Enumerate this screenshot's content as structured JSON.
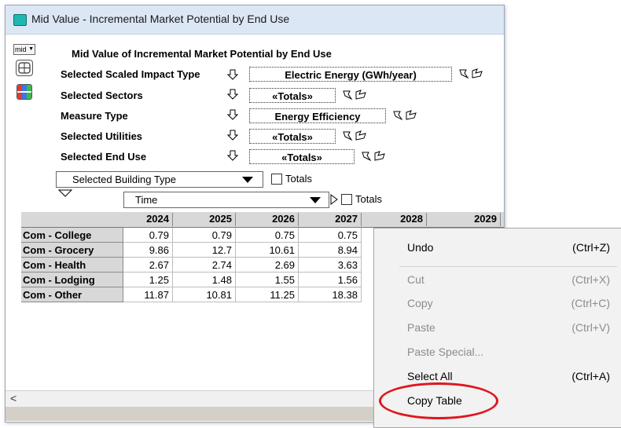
{
  "window": {
    "title": "Mid Value - Incremental Market Potential by End Use",
    "accent_color": "#1fb8b0",
    "titlebar_color": "#dbe7f5"
  },
  "mid_selector": {
    "value": "mid"
  },
  "panel": {
    "title": "Mid Value of Incremental Market Potential by End Use",
    "rows": [
      {
        "label": "Selected Scaled Impact Type",
        "value": "Electric Energy (GWh/year)"
      },
      {
        "label": "Selected Sectors",
        "value": "«Totals»"
      },
      {
        "label": "Measure Type",
        "value": "Energy Efficiency"
      },
      {
        "label": "Selected Utilities",
        "value": "«Totals»"
      },
      {
        "label": "Selected End Use",
        "value": "«Totals»"
      }
    ]
  },
  "building_type_select": {
    "value": "Selected Building Type",
    "totals_label": "Totals"
  },
  "time_select": {
    "value": "Time",
    "totals_label": "Totals"
  },
  "table": {
    "columns": [
      "2024",
      "2025",
      "2026",
      "2027",
      "2028",
      "2029"
    ],
    "rows": [
      {
        "label": "Com - College",
        "values": [
          "0.79",
          "0.79",
          "0.75",
          "0.75"
        ]
      },
      {
        "label": "Com - Grocery",
        "values": [
          "9.86",
          "12.7",
          "10.61",
          "8.94"
        ]
      },
      {
        "label": "Com - Health",
        "values": [
          "2.67",
          "2.74",
          "2.69",
          "3.63"
        ]
      },
      {
        "label": "Com - Lodging",
        "values": [
          "1.25",
          "1.48",
          "1.55",
          "1.56"
        ]
      },
      {
        "label": "Com - Other",
        "values": [
          "11.87",
          "10.81",
          "11.25",
          "18.38"
        ]
      }
    ]
  },
  "context_menu": {
    "items": [
      {
        "label": "Undo",
        "shortcut": "(Ctrl+Z)",
        "enabled": true
      },
      {
        "label": "Cut",
        "shortcut": "(Ctrl+X)",
        "enabled": false
      },
      {
        "label": "Copy",
        "shortcut": "(Ctrl+C)",
        "enabled": false
      },
      {
        "label": "Paste",
        "shortcut": "(Ctrl+V)",
        "enabled": false
      },
      {
        "label": "Paste Special...",
        "shortcut": "",
        "enabled": false
      },
      {
        "label": "Select All",
        "shortcut": "(Ctrl+A)",
        "enabled": true
      },
      {
        "label": "Copy Table",
        "shortcut": "",
        "enabled": true
      }
    ],
    "highlight_color": "#e0161d"
  }
}
